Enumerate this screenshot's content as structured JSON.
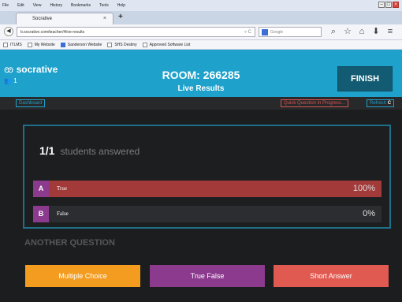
{
  "browser": {
    "menu": [
      "File",
      "Edit",
      "View",
      "History",
      "Bookmarks",
      "Tools",
      "Help"
    ],
    "tab": {
      "label": "Socrative",
      "close": "×"
    },
    "new_tab": "+",
    "url": "b.socrative.com/teacher/#live-results",
    "url_tail": "▿ C",
    "search_placeholder": "Google",
    "nav_icons": [
      "⌕",
      "☆",
      "⌂",
      "⬇",
      "≡"
    ],
    "bookmarks": [
      "ITLMS",
      "My Website",
      "Sanderson Website",
      "SHS Destiny",
      "Approved Software List"
    ]
  },
  "app": {
    "logo": "socrative",
    "user_count": "1",
    "room": "ROOM: 266285",
    "subtitle": "Live Results",
    "finish_label": "FINISH",
    "dashboard_label": "Dashboard",
    "quick_question_label": "Quick Question in Progress...",
    "refresh_label": "Refresh"
  },
  "results": {
    "answered_fraction": "1/1",
    "answered_label": "students answered",
    "options": [
      {
        "letter": "A",
        "label": "True",
        "percent_text": "100%",
        "percent": 1.0
      },
      {
        "letter": "B",
        "label": "False",
        "percent_text": "0%",
        "percent": 0.0
      }
    ]
  },
  "another": {
    "heading": "ANOTHER QUESTION",
    "buttons": [
      "Multiple Choice",
      "True False",
      "Short Answer"
    ]
  },
  "colors": {
    "header": "#1ea1cb",
    "finish": "#135b72",
    "bar": "#a23a3a",
    "letter": "#8b3a8e",
    "multiple_choice": "#f39c1f",
    "true_false": "#8b3a8e",
    "short_answer": "#e05a52"
  }
}
